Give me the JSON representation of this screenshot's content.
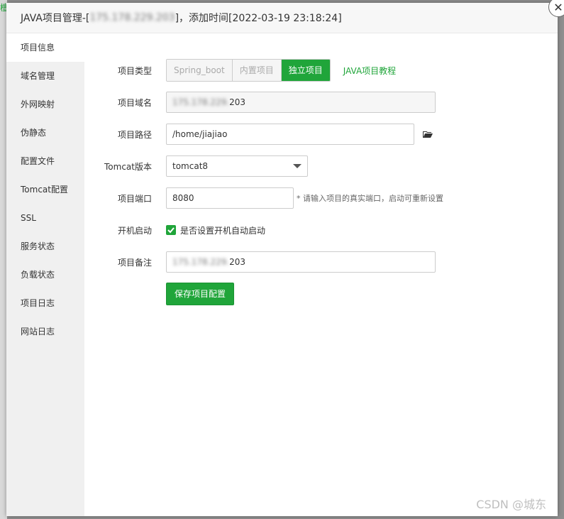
{
  "background": {
    "hint_char": "檀"
  },
  "dialog": {
    "title_prefix": "JAVA项目管理-[",
    "title_ip_masked": " 175.178.229.203 ",
    "title_suffix": "]，添加时间[2022-03-19 23:18:24]",
    "close_glyph": "✕"
  },
  "sidebar": {
    "items": [
      {
        "label": "项目信息"
      },
      {
        "label": "域名管理"
      },
      {
        "label": "外网映射"
      },
      {
        "label": "伪静态"
      },
      {
        "label": "配置文件"
      },
      {
        "label": "Tomcat配置"
      },
      {
        "label": "SSL"
      },
      {
        "label": "服务状态"
      },
      {
        "label": "负载状态"
      },
      {
        "label": "项目日志"
      },
      {
        "label": "网站日志"
      }
    ]
  },
  "form": {
    "project_type": {
      "label": "项目类型",
      "options": [
        "Spring_boot",
        "内置项目",
        "独立项目"
      ],
      "selected": "独立项目",
      "tutorial_link": "JAVA项目教程"
    },
    "domain": {
      "label": "项目域名",
      "value_masked": "175.178.229.",
      "value_tail": "203"
    },
    "path": {
      "label": "项目路径",
      "value": "/home/jiajiao"
    },
    "tomcat": {
      "label": "Tomcat版本",
      "value": "tomcat8"
    },
    "port": {
      "label": "项目端口",
      "value": "8080",
      "hint": "* 请输入项目的真实端口，启动可重新设置"
    },
    "autostart": {
      "label": "开机启动",
      "checkbox_label": "是否设置开机自动启动",
      "checked": true
    },
    "remark": {
      "label": "项目备注",
      "value_masked": "175.178.229.",
      "value_tail": "203"
    },
    "save_label": "保存项目配置"
  },
  "watermark": "CSDN @城东",
  "colors": {
    "accent": "#20a53a",
    "sidebar_bg": "#f0f0f0",
    "overlay": "#8f8f8f"
  },
  "icons": {
    "folder": "folder-open-icon",
    "check": "check-icon",
    "close": "close-icon",
    "caret": "caret-down-icon"
  }
}
